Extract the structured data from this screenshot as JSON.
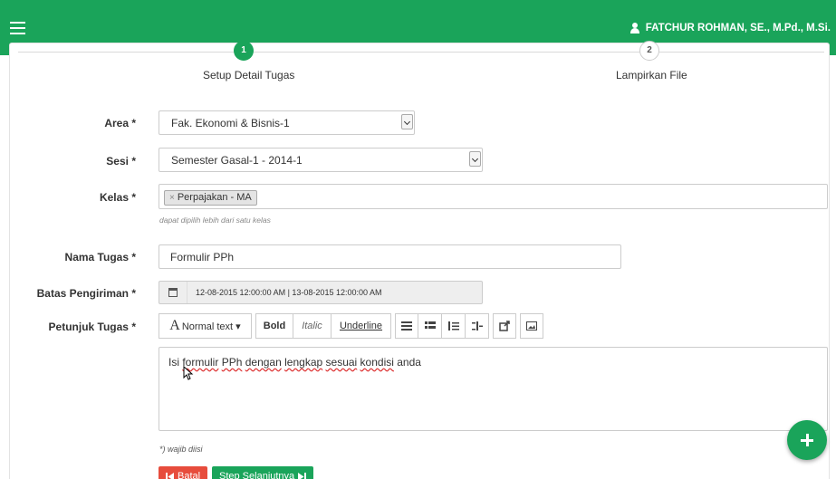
{
  "header": {
    "menu_icon": "hamburger-icon",
    "user_icon": "user-icon",
    "user_name": "FATCHUR ROHMAN, SE., M.Pd., M.Si."
  },
  "wizard": {
    "steps": [
      {
        "number": "1",
        "label": "Setup Detail Tugas",
        "active": true
      },
      {
        "number": "2",
        "label": "Lampirkan File",
        "active": false
      }
    ]
  },
  "form": {
    "area": {
      "label": "Area *",
      "value": "Fak. Ekonomi & Bisnis-1"
    },
    "sesi": {
      "label": "Sesi *",
      "value": "Semester Gasal-1 - 2014-1"
    },
    "kelas": {
      "label": "Kelas *",
      "tag": "Perpajakan - MA",
      "tag_remove": "×",
      "help": "dapat dipilih lebih dari satu kelas"
    },
    "nama_tugas": {
      "label": "Nama Tugas *",
      "value": "Formulir PPh"
    },
    "batas_pengiriman": {
      "label": "Batas Pengiriman *",
      "icon": "calendar-icon",
      "value": "12-08-2015 12:00:00 AM | 13-08-2015 12:00:00 AM"
    },
    "petunjuk_tugas": {
      "label": "Petunjuk Tugas *",
      "toolbar": {
        "font_glyph": "A",
        "font_style": "Normal text ▾",
        "bold": "Bold",
        "italic": "Italic",
        "underline": "Underline"
      },
      "content": {
        "w1": "Isi",
        "w2": "formulir",
        "w3": "PPh",
        "w4": "dengan",
        "w5": "lengkap",
        "w6": "sesuai",
        "w7": "kondisi",
        "w8": "anda"
      }
    },
    "required_note": "*) wajib diisi"
  },
  "actions": {
    "cancel": "Batal",
    "next": "Step Selanjutnya"
  },
  "colors": {
    "primary": "#1aa45a",
    "danger": "#e74c3c"
  }
}
